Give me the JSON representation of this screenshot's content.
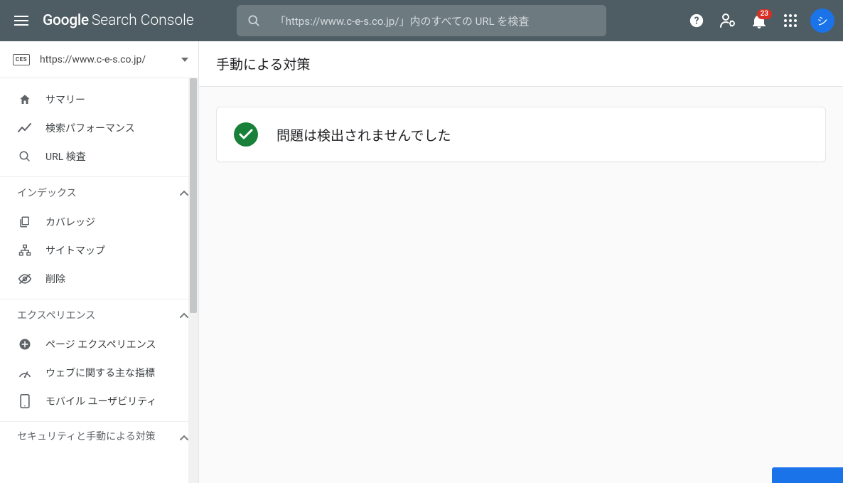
{
  "header": {
    "logo_google": "Google",
    "logo_console": "Search Console",
    "search_placeholder": "「https://www.c-e-s.co.jp/」内のすべての URL を検査",
    "notification_count": "23",
    "avatar_initial": "シ"
  },
  "property": {
    "badge": "CES",
    "url": "https://www.c-e-s.co.jp/"
  },
  "nav": {
    "items_top": [
      {
        "icon": "home",
        "label": "サマリー"
      },
      {
        "icon": "trend",
        "label": "検索パフォーマンス"
      },
      {
        "icon": "search",
        "label": "URL 検査"
      }
    ],
    "sections": [
      {
        "title": "インデックス",
        "items": [
          {
            "icon": "copies",
            "label": "カバレッジ"
          },
          {
            "icon": "sitemap",
            "label": "サイトマップ"
          },
          {
            "icon": "hide",
            "label": "削除"
          }
        ]
      },
      {
        "title": "エクスペリエンス",
        "items": [
          {
            "icon": "plus-circle",
            "label": "ページ エクスペリエンス"
          },
          {
            "icon": "gauge",
            "label": "ウェブに関する主な指標"
          },
          {
            "icon": "mobile",
            "label": "モバイル ユーザビリティ"
          }
        ]
      },
      {
        "title": "セキュリティと手動による対策",
        "items": []
      }
    ]
  },
  "main": {
    "title": "手動による対策",
    "status_message": "問題は検出されませんでした"
  }
}
